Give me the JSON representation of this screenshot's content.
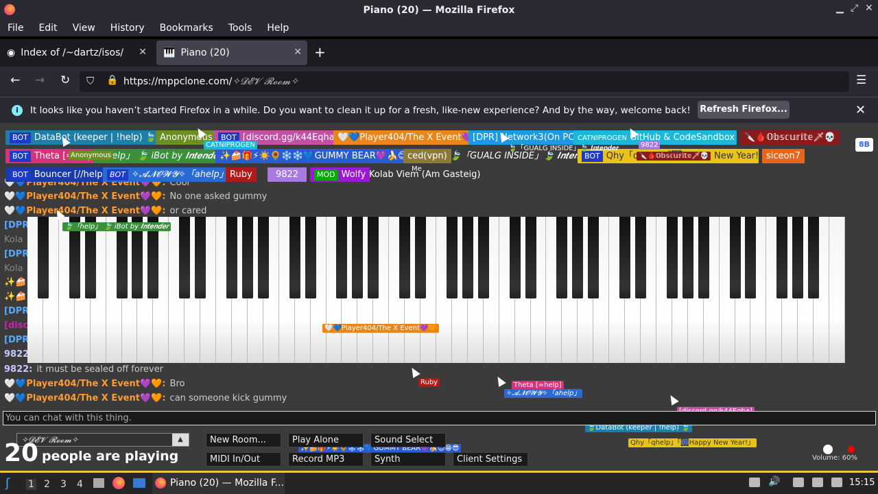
{
  "window": {
    "title": "Piano (20) — Mozilla Firefox"
  },
  "menu": [
    "File",
    "Edit",
    "View",
    "History",
    "Bookmarks",
    "Tools",
    "Help"
  ],
  "tabs": [
    {
      "label": "Index of /~dartz/isos/"
    },
    {
      "label": "Piano (20)"
    }
  ],
  "url": {
    "host": "https://mppclone.com/",
    "room": "✧𝓓𝓔𝓥 𝓡𝓸𝓸𝓶✧"
  },
  "notification": {
    "message": "It looks like you haven’t started Firefox in a while. Do you want to clean it up for a fresh, like-new experience? And by the way, welcome back!",
    "button": "Refresh Firefox..."
  },
  "users": {
    "databot": "DataBot (keeper | !help) 🍃",
    "anonymous": "Anonymous",
    "discord": "[discord.gg/k44Eqha]",
    "player404": "🤍💙Player404/The X Event💜🧡",
    "dpr": "[DPR] Network3(On PC)",
    "github": "GitHub & CodeSandbox",
    "obscurite": "🔪🩸𝕆𝕓𝕤𝕔𝕦𝕣𝕚𝕥𝕖🗡💀",
    "theta": "Theta [=help]",
    "ibot": "「help」 🍃 iBot by 𝑰𝒏𝒕𝒆𝒏𝒅𝒆𝒓",
    "gummy": "✨🍰🎁⚡☀️🌻❄️❄️💙GUMMY BEAR💜🍌😊😁😎😊",
    "ced": "ced(vpn)",
    "gualg": "🍃「GUALG INSIDE」🍃 𝑰𝒏𝒕𝒆𝒏𝒅𝒆𝒓",
    "qhy": "Qhy「qhelp」「🎆Happy New Year!」",
    "siceon": "siceon7",
    "bouncer": "Bouncer [//help]",
    "anowy": "✧𝓐𝓝𝓞𝓦𝓨✧「ahelp」",
    "ruby": "Ruby",
    "n9822": "9822",
    "wolfy": "Wolfy",
    "kolab": "Kolab Viem (Am Gasteig)",
    "me": "Me"
  },
  "badges": {
    "bot": "BOT",
    "mod": "MOD"
  },
  "mini_labels": {
    "catnip": "CATNIPROGEN",
    "gualg_small": "🍃「GUALG INSIDE」🍃 𝑰𝒏𝒕𝒆𝒏𝒅𝒆𝒓",
    "ibot_small": "🍃「help」 🍃 iBot by 𝑰𝒏𝒕𝒆𝒏𝒅𝒆𝒓",
    "player_small": "🤍💙Player404/The X Event💜🧡",
    "ruby_small": "Ruby",
    "theta_small": "Theta [=help]",
    "anowy_small": "✧𝓐𝓝𝓞𝓦𝓨✧「ahelp」",
    "discord_small": "[discord.gg/k44Eqha]",
    "databot_small": "🍃DataBot (keeper | !help) 🍃",
    "qhy_small": "Qhy「qhelp」「🎆Happy New Year!」",
    "gummy_small": "✨🍰🎁⚡☀️🌻❄️❄️💙GUMMY BEAR💜🍌😊😁😎",
    "n9822_small": "9822",
    "obscurite_small": "🔪🩸𝕆𝕓𝕤𝕔𝕦𝕣𝕚𝕥𝕖🗡💀",
    "anon_small": "Anonymous"
  },
  "chat": [
    {
      "hearts": "🤍💙",
      "name": "Player404/The X Event💜🧡:",
      "text": "Cool"
    },
    {
      "hearts": "🤍💙",
      "name": "Player404/The X Event💜🧡:",
      "text": "No one asked gummy"
    },
    {
      "hearts": "🤍💙",
      "name": "Player404/The X Event💜🧡:",
      "text": "or cared"
    }
  ],
  "chat_bottom": [
    {
      "name": "9822:",
      "text": "it must be sealed off forever"
    },
    {
      "hearts": "🤍💙",
      "name": "Player404/The X Event💜🧡:",
      "text": "Bro"
    },
    {
      "hearts": "🤍💙",
      "name": "Player404/The X Event💜🧡:",
      "text": "can someone kick gummy"
    }
  ],
  "side_names": [
    "[DPR",
    "Kola",
    "[DPR",
    "Kola",
    "✨🍰",
    "✨🍰",
    "[DPR",
    "[disc",
    "[DPR",
    "9822"
  ],
  "chat_input": {
    "placeholder": "You can chat with this thing."
  },
  "room_select": "✧𝓓𝓔𝓥 𝓡𝓸𝓸𝓶✧",
  "people": {
    "count": "20",
    "label": "people are playing"
  },
  "buttons": {
    "new_room": "New Room...",
    "play_alone": "Play Alone",
    "sound_select": "Sound Select",
    "midi": "MIDI In/Out",
    "record": "Record MP3",
    "synth": "Synth",
    "client_settings": "Client Settings"
  },
  "volume": "Volume: 60%",
  "taskbar": {
    "workspaces": [
      "1",
      "2",
      "3",
      "4"
    ],
    "window": "Piano (20) — Mozilla F...",
    "clock": "15:15"
  },
  "colors": {
    "bot": "#1e3ac9",
    "mod": "#00aa00",
    "accent": "#f4c542"
  }
}
